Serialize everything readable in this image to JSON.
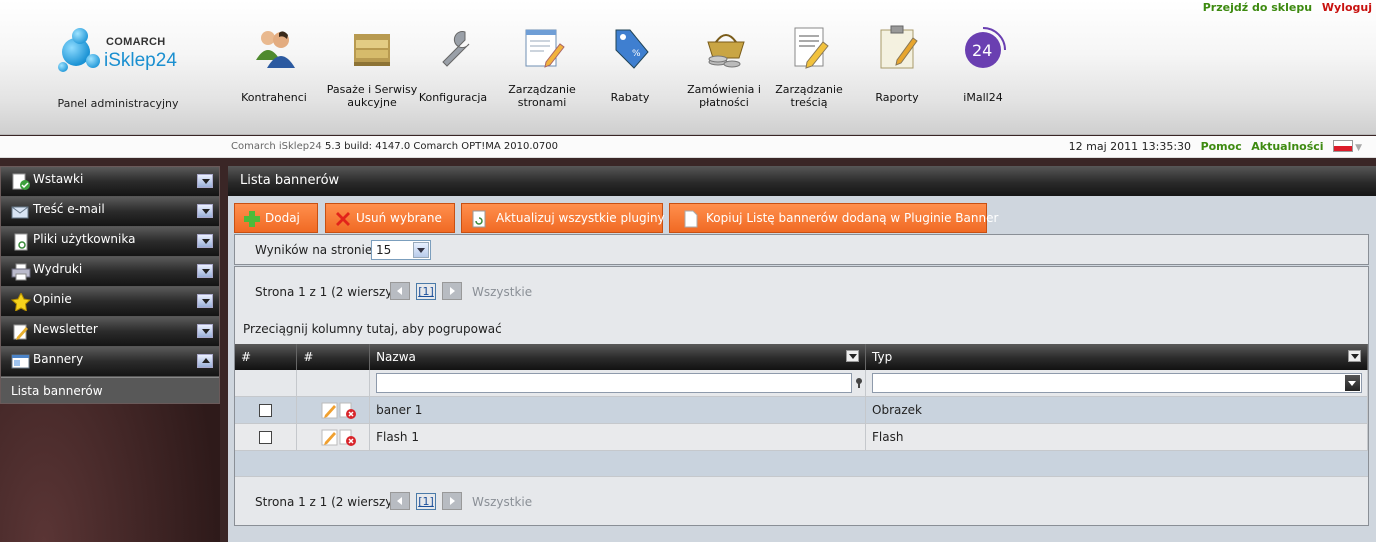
{
  "header": {
    "links": {
      "shop": "Przejdź do sklepu",
      "logout": "Wyloguj"
    },
    "logo": {
      "company": "COMARCH",
      "product": "iSklep24"
    },
    "panel_label": "Panel administracyjny",
    "nav": [
      {
        "label": "Kontrahenci",
        "icon": "users-icon"
      },
      {
        "label": "Pasaże i Serwisy aukcyjne",
        "icon": "folders-icon"
      },
      {
        "label": "Konfiguracja",
        "icon": "wrench-icon"
      },
      {
        "label": "Zarządzanie stronami",
        "icon": "page-edit-icon"
      },
      {
        "label": "Rabaty",
        "icon": "discount-tag-icon"
      },
      {
        "label": "Zamówienia i płatności",
        "icon": "basket-coins-icon"
      },
      {
        "label": "Zarządzanie treścią",
        "icon": "document-edit-icon"
      },
      {
        "label": "Raporty",
        "icon": "clipboard-icon"
      },
      {
        "label": "iMall24",
        "icon": "imall24-icon"
      }
    ]
  },
  "statusbar": {
    "version_app": "Comarch iSklep24",
    "version_build": "5.3 build: 4147.0",
    "version_erp": "Comarch OPT!MA 2010.0700",
    "datetime": "12 maj 2011 13:35:30",
    "help": "Pomoc",
    "news": "Aktualności"
  },
  "sidebar": {
    "items": [
      {
        "label": "Wstawki",
        "icon": "page-check-icon",
        "expanded": false
      },
      {
        "label": "Treść e-mail",
        "icon": "envelope-icon",
        "expanded": false
      },
      {
        "label": "Pliki użytkownika",
        "icon": "file-refresh-icon",
        "expanded": false
      },
      {
        "label": "Wydruki",
        "icon": "printer-icon",
        "expanded": false
      },
      {
        "label": "Opinie",
        "icon": "star-icon",
        "expanded": false
      },
      {
        "label": "Newsletter",
        "icon": "newsletter-icon",
        "expanded": false
      },
      {
        "label": "Bannery",
        "icon": "banner-icon",
        "expanded": true
      }
    ],
    "subitem": "Lista bannerów"
  },
  "main": {
    "title": "Lista bannerów",
    "toolbar": {
      "add": "Dodaj",
      "delete": "Usuń wybrane",
      "update": "Aktualizuj wszystkie pluginy",
      "copy": "Kopiuj Listę bannerów dodaną w Pluginie Banner"
    },
    "per_page_label": "Wyników na stronie:",
    "per_page_value": "15",
    "pager": {
      "text": "Strona 1 z 1 (2 wierszy)",
      "current": "[1]",
      "all": "Wszystkie"
    },
    "group_hint": "Przeciągnij kolumny tutaj, aby pogrupować",
    "columns": [
      "#",
      "#",
      "Nazwa",
      "Typ"
    ],
    "rows": [
      {
        "name": "baner 1",
        "type": "Obrazek"
      },
      {
        "name": "Flash 1",
        "type": "Flash"
      }
    ]
  },
  "colors": {
    "accent_orange": "#f06a24",
    "link_green": "#3d8a10",
    "link_red": "#c8120f",
    "brand_blue": "#1a8fd0"
  }
}
